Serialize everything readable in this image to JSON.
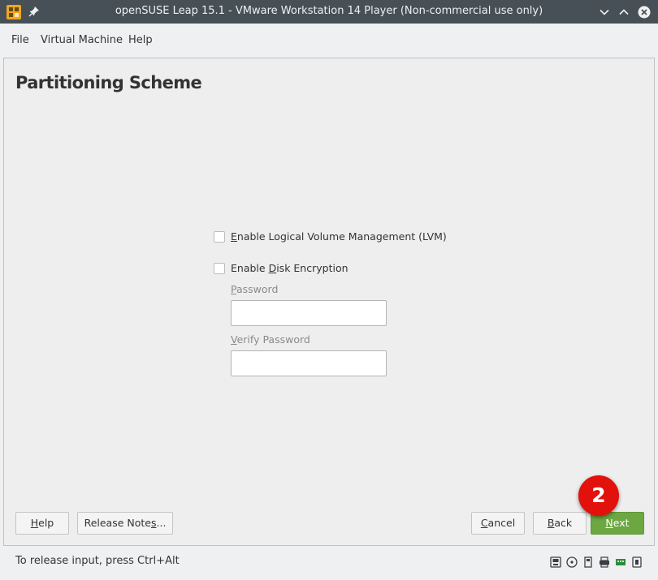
{
  "window": {
    "title": "openSUSE Leap 15.1 - VMware Workstation 14 Player (Non-commercial use only)"
  },
  "menu": {
    "file": "File",
    "virtual_machine": "Virtual Machine",
    "help": "Help"
  },
  "installer": {
    "page_title": "Partitioning Scheme",
    "lvm": {
      "key": "E",
      "rest": "nable Logical Volume Management (LVM)",
      "checked": false
    },
    "encryption": {
      "pre": "Enable ",
      "key": "D",
      "rest": "isk Encryption",
      "checked": false
    },
    "password": {
      "key": "P",
      "rest": "assword",
      "value": ""
    },
    "verify_password": {
      "key": "V",
      "rest": "erify Password",
      "value": ""
    },
    "buttons": {
      "help": {
        "key": "H",
        "rest": "elp"
      },
      "release_notes": {
        "pre": "Release Note",
        "key": "s",
        "rest": "..."
      },
      "cancel": {
        "key": "C",
        "rest": "ancel"
      },
      "back": {
        "key": "B",
        "rest": "ack"
      },
      "next": {
        "key": "N",
        "rest": "ext"
      }
    }
  },
  "step_badge": "2",
  "statusbar": {
    "message": "To release input, press Ctrl+Alt",
    "devices": [
      "hard-disk-icon",
      "cd-drive-icon",
      "usb-icon",
      "printer-icon",
      "network-icon",
      "sound-icon"
    ]
  },
  "colors": {
    "titlebar": "#475057",
    "next_button": "#6da741",
    "badge": "#e3110b"
  }
}
